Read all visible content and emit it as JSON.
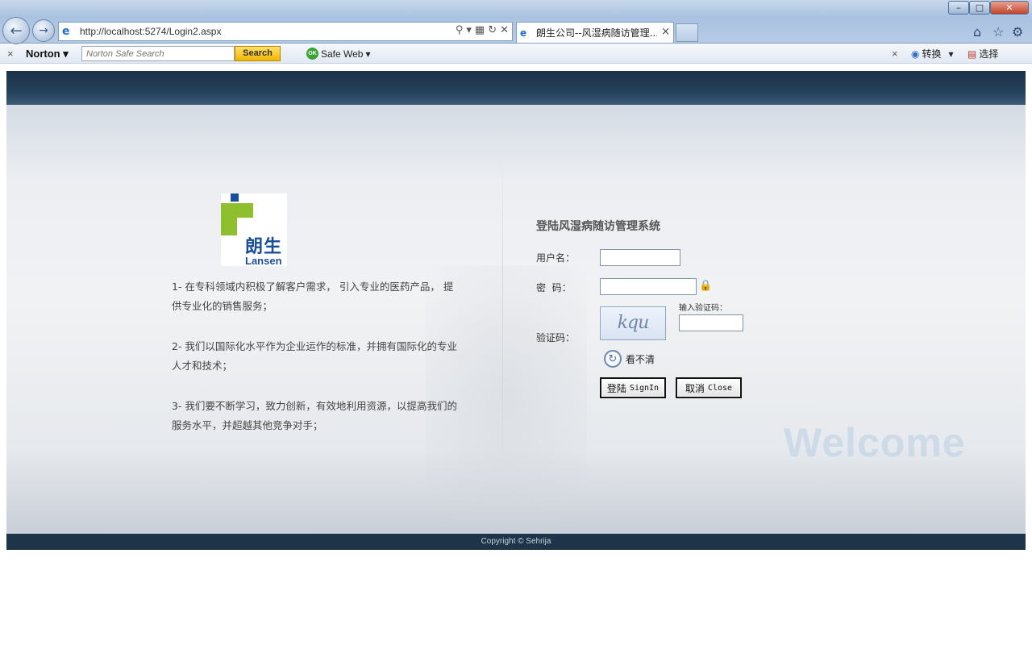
{
  "browser": {
    "address_url": "http://localhost:5274/Login2.aspx",
    "tab_title": "朗生公司--风湿病随访管理...",
    "tab_close": "×",
    "back_icon": "back-arrow-icon",
    "forward_icon": "forward-arrow-icon",
    "window_min": "–",
    "window_max": "□",
    "window_close": "✕"
  },
  "norton_toolbar": {
    "close": "×",
    "logo": "Norton",
    "search_placeholder": "Norton Safe Search",
    "search_button": "Search",
    "ok_badge": "OK",
    "safe_web": "Safe Web",
    "close_right": "×",
    "convert": "转换",
    "select": "选择"
  },
  "logo": {
    "cn": "朗生",
    "en": "Lansen"
  },
  "descriptions": [
    "1- 在专科领域内积极了解客户需求， 引入专业的医药产品， 提供专业化的销售服务；",
    "2- 我们以国际化水平作为企业运作的标准，并拥有国际化的专业人才和技术；",
    "3- 我们要不断学习，致力创新，有效地利用资源，以提高我们的服务水平，并超越其他竞争对手；"
  ],
  "login": {
    "title": "登陆风湿病随访管理系统",
    "username_label": "用户名：",
    "password_label": "密  码：",
    "code_label": "验证码：",
    "code_hint": "输入验证码：",
    "captcha_text": "kqu",
    "refresh_label": "看不清",
    "signin_cn": "登陆",
    "signin_en": "SignIn",
    "close_cn": "取消",
    "close_en": "Close",
    "username_value": "",
    "password_value": "",
    "code_value": ""
  },
  "welcome": "Welcome",
  "footer": "Copyright © Sehrija"
}
